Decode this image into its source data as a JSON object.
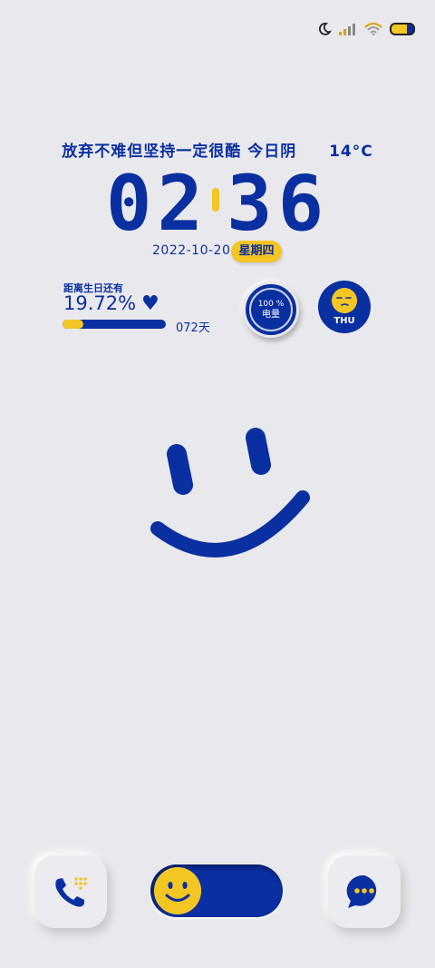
{
  "status_bar": {
    "icons": [
      "moon-icon",
      "signal-icon",
      "wifi-icon",
      "battery-icon"
    ]
  },
  "header": {
    "motto": "放弃不难但坚持一定很酷 今日阴",
    "temperature": "14°C",
    "hour": "02",
    "minute": "36",
    "date": "2022-10-20",
    "weekday": "星期四"
  },
  "birthday": {
    "title": "距离生日还有",
    "percent": "19.72%",
    "progress": 0.2,
    "days_label": "072天"
  },
  "battery_widget": {
    "percent": "100 %",
    "label": "电量"
  },
  "day_widget": {
    "label": "THU"
  },
  "dock": {
    "items": [
      "phone-icon",
      "smile-toggle",
      "message-icon"
    ]
  },
  "colors": {
    "primary": "#0a2fa0",
    "accent": "#f3c623",
    "background": "#e9e8ec"
  }
}
